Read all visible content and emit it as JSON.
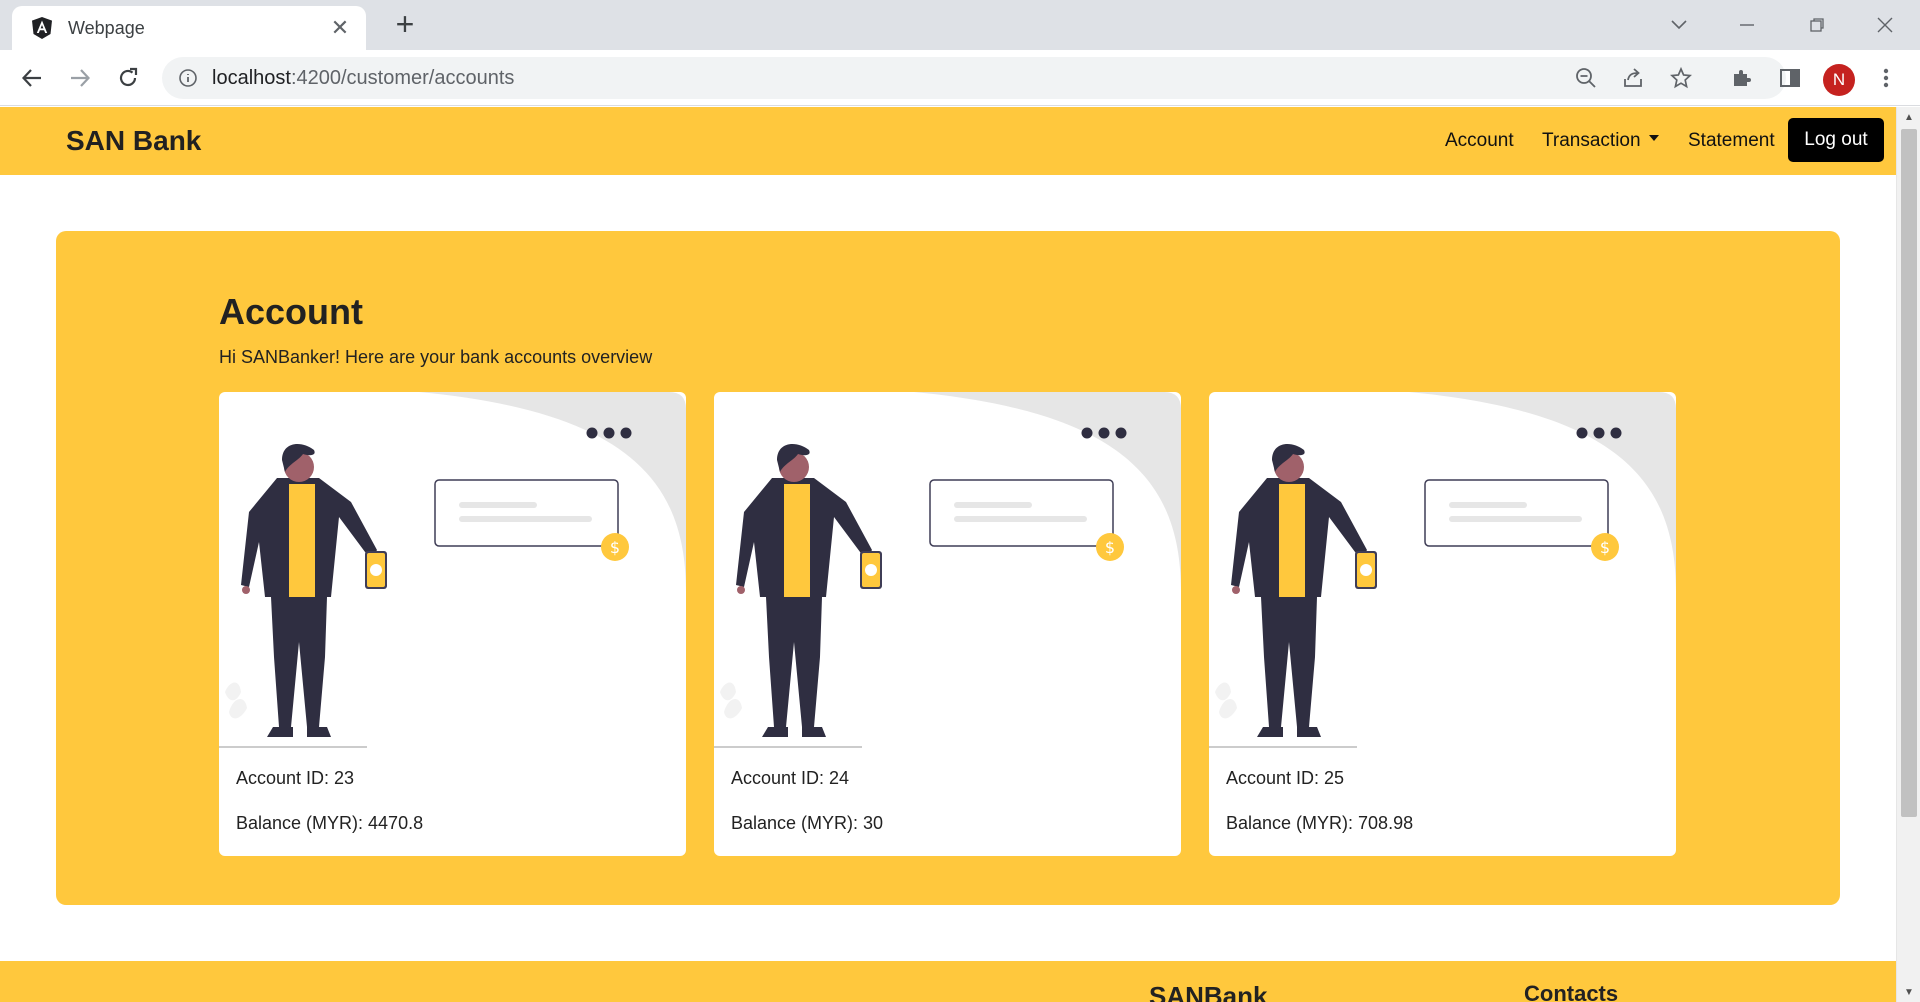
{
  "browser": {
    "tab_title": "Webpage",
    "url_host": "localhost",
    "url_path": ":4200/customer/accounts",
    "profile_initial": "N",
    "icons": [
      "angular-icon",
      "close-icon",
      "plus-icon",
      "chevron-down-icon",
      "minimize-icon",
      "restore-icon",
      "window-close-icon",
      "back-icon",
      "forward-icon",
      "reload-icon",
      "info-icon",
      "zoom-out-icon",
      "share-icon",
      "star-icon",
      "extensions-icon",
      "side-panel-icon",
      "menu-icon"
    ]
  },
  "navbar": {
    "brand": "SAN Bank",
    "links": {
      "account": "Account",
      "transaction": "Transaction",
      "statement": "Statement"
    },
    "logout": "Log out",
    "color": "#ffc83d"
  },
  "main": {
    "title": "Account",
    "subtitle": "Hi SANBanker! Here are your bank accounts overview",
    "accounts": [
      {
        "id_label": "Account ID: 23",
        "balance_label": "Balance (MYR): 4470.8"
      },
      {
        "id_label": "Account ID: 24",
        "balance_label": "Balance (MYR): 30"
      },
      {
        "id_label": "Account ID: 25",
        "balance_label": "Balance (MYR): 708.98"
      }
    ]
  },
  "footer": {
    "brand": "SANBank",
    "contacts": "Contacts"
  }
}
